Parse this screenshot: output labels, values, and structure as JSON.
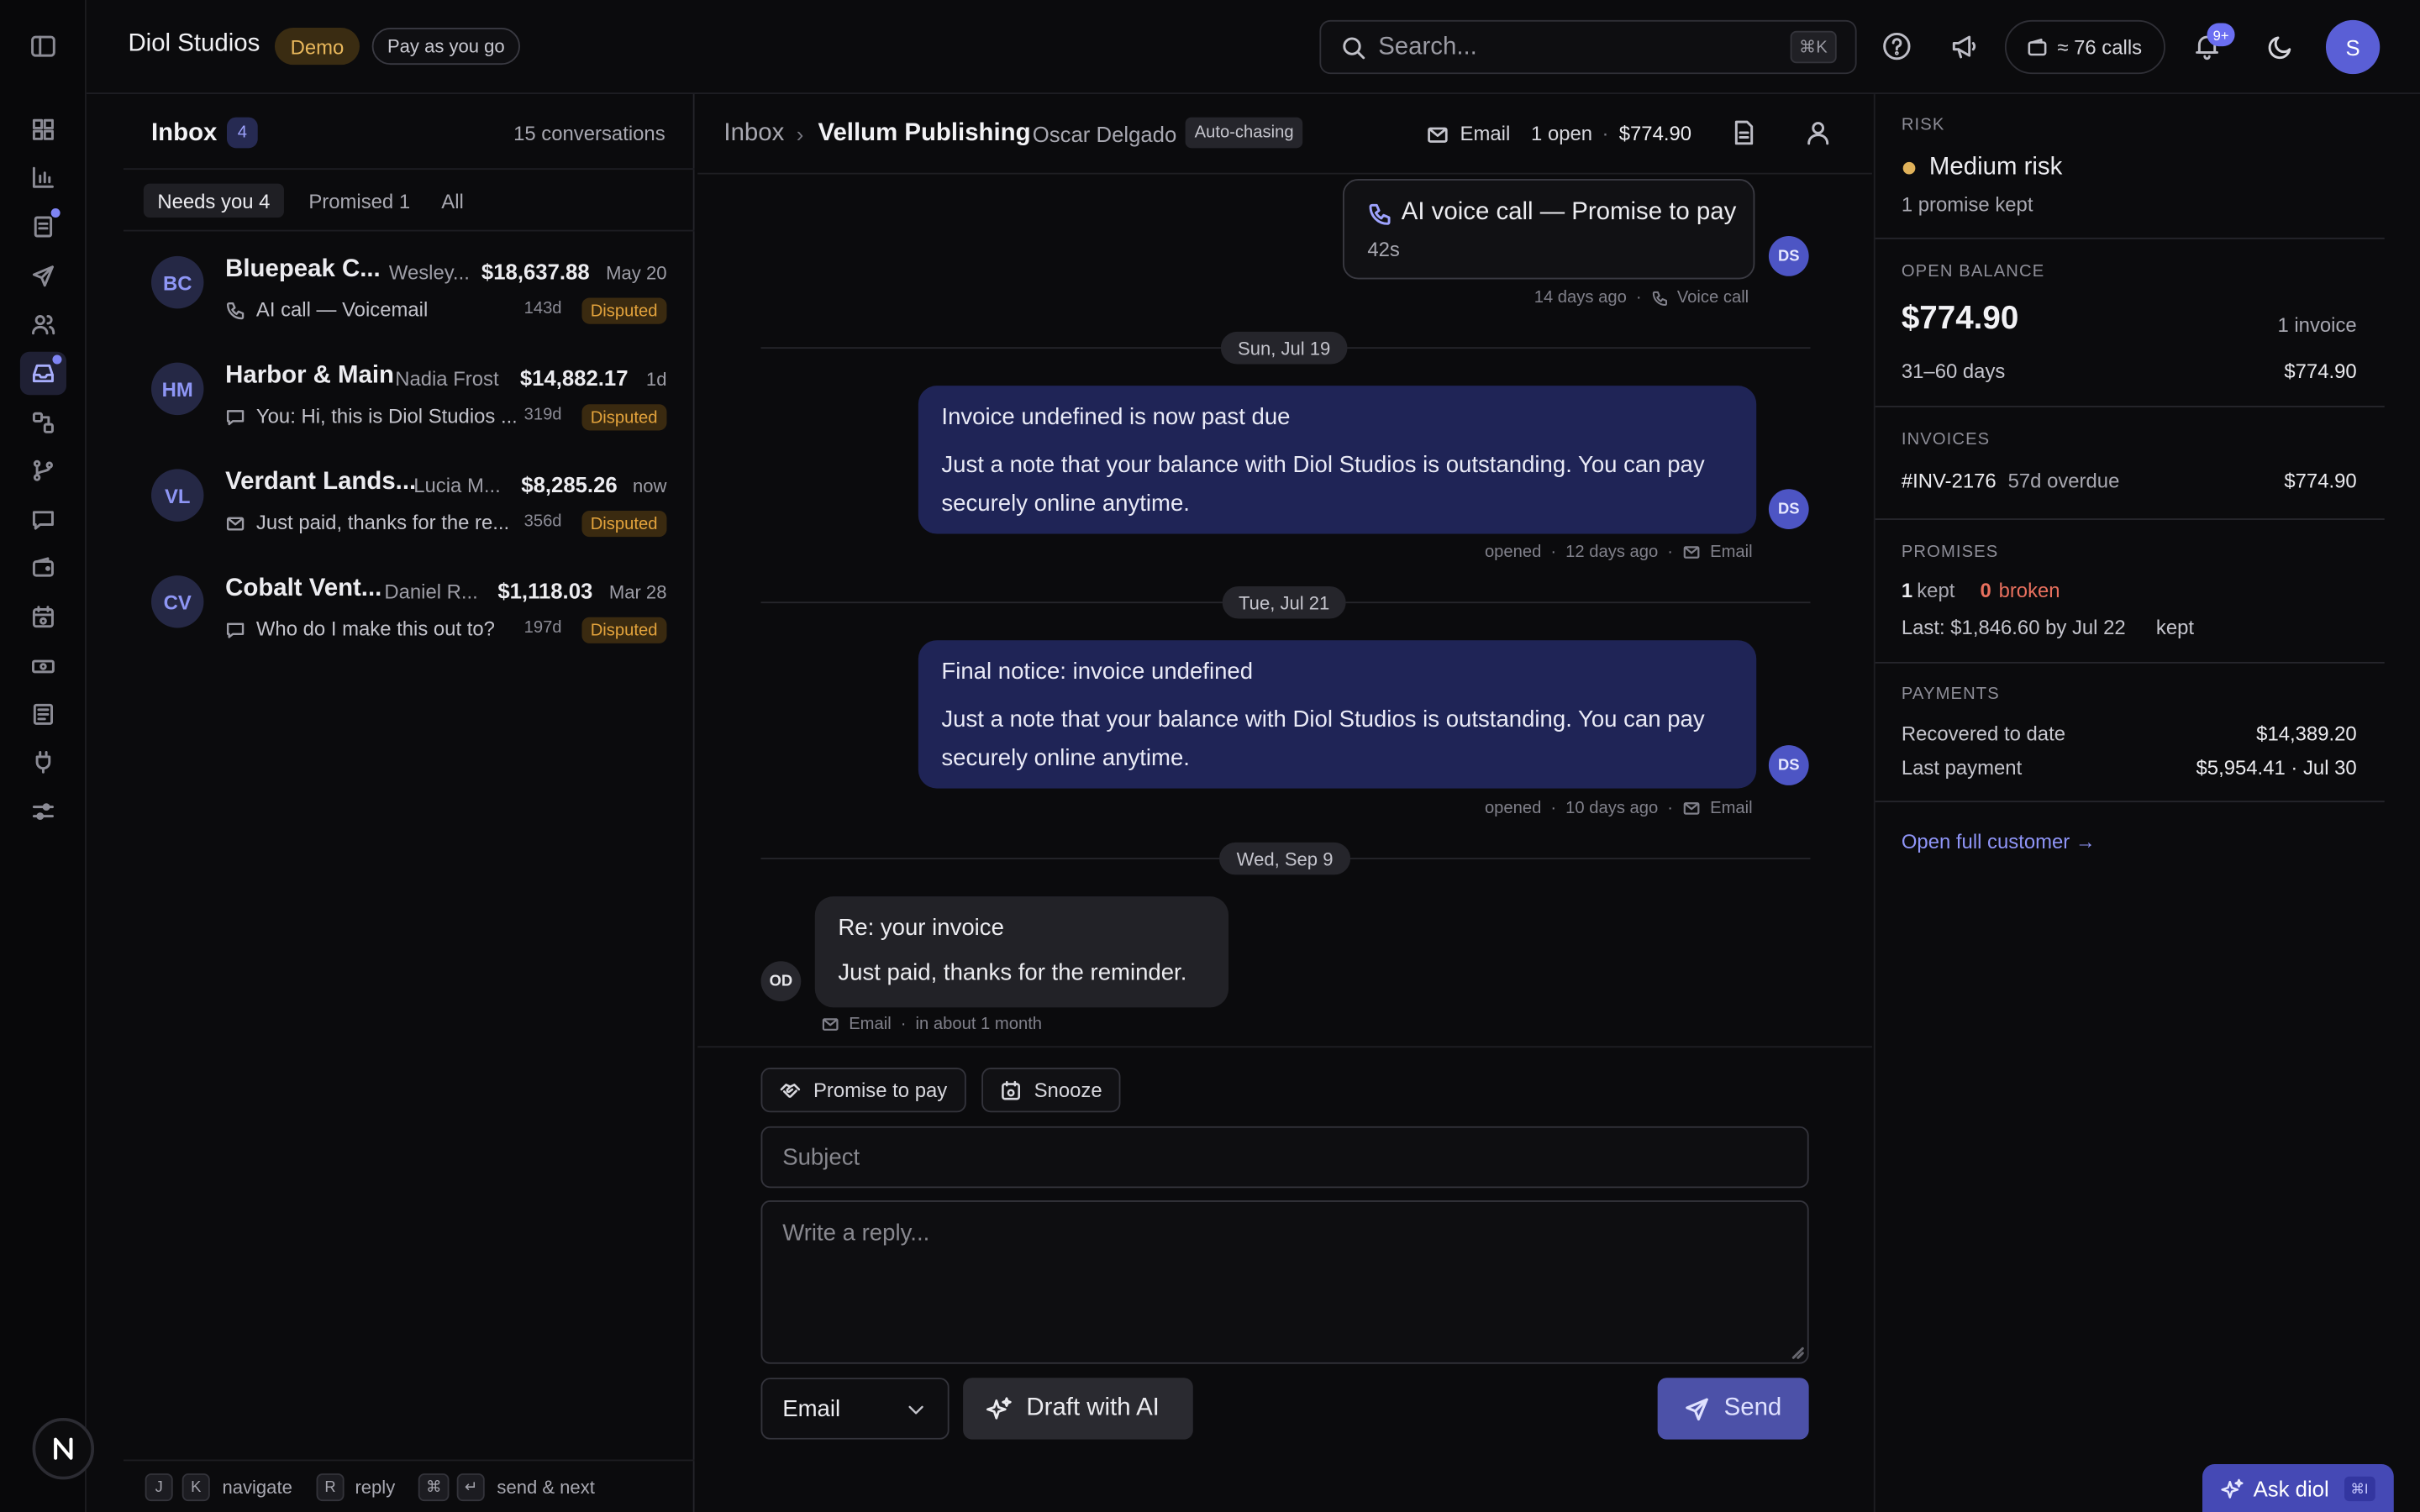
{
  "brand": {
    "name": "Diol Studios",
    "demo_badge": "Demo",
    "plan_badge": "Pay as you go"
  },
  "header": {
    "search_placeholder": "Search...",
    "search_shortcut": "⌘K",
    "calls_label": "≈ 76 calls",
    "notifications_count": "9+",
    "user_initial": "S"
  },
  "inbox": {
    "title": "Inbox",
    "count": "4",
    "total_label": "15 conversations",
    "tabs": [
      "Needs you 4",
      "Promised 1",
      "All"
    ],
    "conversations": [
      {
        "initials": "BC",
        "name": "Bluepeak C...",
        "contact": "Wesley...",
        "amount": "$18,637.88",
        "date": "May 20",
        "channel": "phone",
        "preview": "AI call — Voicemail",
        "age": "143d",
        "status": "Disputed"
      },
      {
        "initials": "HM",
        "name": "Harbor & Main",
        "contact": "Nadia Frost",
        "amount": "$14,882.17",
        "date": "1d",
        "channel": "chat",
        "preview": "You: Hi, this is Diol Studios ...",
        "age": "319d",
        "status": "Disputed"
      },
      {
        "initials": "VL",
        "name": "Verdant Lands...",
        "contact": "Lucia M...",
        "amount": "$8,285.26",
        "date": "now",
        "channel": "mail",
        "preview": "Just paid, thanks for the re...",
        "age": "356d",
        "status": "Disputed"
      },
      {
        "initials": "CV",
        "name": "Cobalt Vent...",
        "contact": "Daniel R...",
        "amount": "$1,118.03",
        "date": "Mar 28",
        "channel": "chat",
        "preview": "Who do I make this out to?",
        "age": "197d",
        "status": "Disputed"
      }
    ]
  },
  "shortcuts": {
    "j": "J",
    "k": "K",
    "navigate": "navigate",
    "r": "R",
    "reply": "reply",
    "cmd": "⌘",
    "enter": "↵",
    "send_next": "send & next"
  },
  "thread": {
    "breadcrumb_root": "Inbox",
    "breadcrumb_sep": "›",
    "customer": "Vellum Publishing",
    "contact": "Oscar Delgado",
    "auto_badge": "Auto-chasing",
    "channel": "Email",
    "open_count": "1 open",
    "dot": "·",
    "open_amount": "$774.90",
    "messages": {
      "call": {
        "title": "AI voice call — Promise to pay",
        "duration": "42s",
        "time": "14 days ago",
        "kind": "Voice call",
        "avatar": "DS"
      },
      "date1": "Sun, Jul 19",
      "m1": {
        "title": "Invoice undefined is now past due",
        "body": "Just a note that your balance with Diol Studios is outstanding. You can pay securely online anytime.",
        "status": "opened",
        "time": "12 days ago",
        "kind": "Email",
        "avatar": "DS"
      },
      "date2": "Tue, Jul 21",
      "m2": {
        "title": "Final notice: invoice undefined",
        "body": "Just a note that your balance with Diol Studios is outstanding. You can pay securely online anytime.",
        "status": "opened",
        "time": "10 days ago",
        "kind": "Email",
        "avatar": "DS"
      },
      "date3": "Wed, Sep 9",
      "m3": {
        "title": "Re: your invoice",
        "body": "Just paid, thanks for the reminder.",
        "kind": "Email",
        "time": "in about 1 month",
        "avatar": "OD"
      }
    }
  },
  "composer": {
    "promise_label": "Promise to pay",
    "snooze_label": "Snooze",
    "subject_placeholder": "Subject",
    "reply_placeholder": "Write a reply...",
    "channel_value": "Email",
    "draft_label": "Draft with AI",
    "send_label": "Send"
  },
  "side": {
    "risk_title": "RISK",
    "risk_level": "Medium risk",
    "risk_note": "1 promise kept",
    "balance_title": "OPEN BALANCE",
    "balance_amount": "$774.90",
    "balance_invoices": "1 invoice",
    "bucket_label": "31–60 days",
    "bucket_amount": "$774.90",
    "invoices_title": "INVOICES",
    "invoice_id": "#INV-2176",
    "invoice_status": "57d overdue",
    "invoice_amount": "$774.90",
    "promises_title": "PROMISES",
    "kept_count": "1",
    "kept_label": "kept",
    "broken_count": "0",
    "broken_label": "broken",
    "last_promise": "Last: $1,846.60 by Jul 22",
    "last_promise_status": "kept",
    "payments_title": "PAYMENTS",
    "recovered_label": "Recovered to date",
    "recovered_amount": "$14,389.20",
    "last_payment_label": "Last payment",
    "last_payment_value": "$5,954.41 · Jul 30",
    "open_customer": "Open full customer →"
  },
  "ask": {
    "label": "Ask diol",
    "shortcut": "⌘I"
  },
  "colors": {
    "accent": "#7f85f5",
    "bubble": "#1f2456",
    "disputed": "#e3a33c",
    "risk": "#e0b25a",
    "broken": "#e8705e"
  }
}
